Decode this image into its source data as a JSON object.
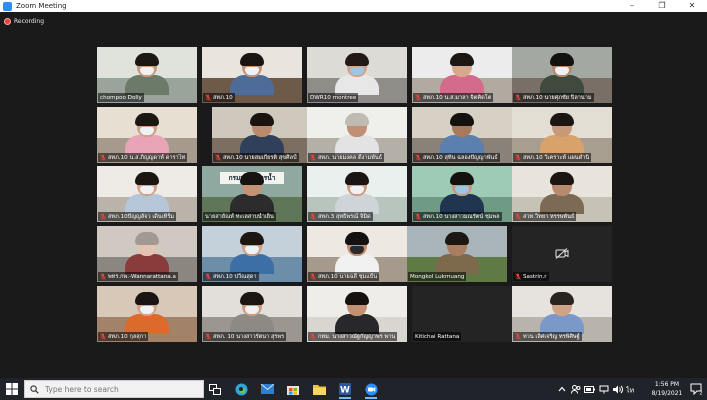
{
  "window": {
    "title": "Zoom Meeting",
    "controls": [
      "–",
      "❐",
      "✕"
    ]
  },
  "recording": {
    "label": "Recording",
    "color": "#e2443a"
  },
  "active_speaker_color": "#a6d64a",
  "participants": [
    {
      "name": "chompoo Dolly",
      "muted": false,
      "active": true
    },
    {
      "name": "สทภ.10",
      "muted": true
    },
    {
      "name": "DWR10 montree",
      "muted": false
    },
    {
      "name": "สทภ.10 น.ส.มาลา จิตคิดโต",
      "muted": true
    },
    {
      "name": "สทภ.10 นายศุภชัย ปิลานาม",
      "muted": true
    },
    {
      "name": "สทภ.10 น.ส.ภิญญดาห์ ดาราไท",
      "muted": true
    },
    {
      "name": "สทภ.10 นายสมเกียรติ สุขศิลป์",
      "muted": true
    },
    {
      "name": "สทภ. นายมงคล ดีงามพันธ์",
      "muted": true
    },
    {
      "name": "สทภ.10 สุทิน ฉลองปัญญาพันธ์",
      "muted": true
    },
    {
      "name": "สทภ.10 วิเคราะห์ แผนดำนิ",
      "muted": true
    },
    {
      "name": "สทภ.10ปัญญลัจว เดินเทิร์ม",
      "muted": true
    },
    {
      "name": "นายสายัณห์ ทะเลสาบน้ำเย็น",
      "muted": false
    },
    {
      "name": "สทภ.3 สุทธิพรณ์ จิมิด",
      "muted": true
    },
    {
      "name": "สทภ.10 นางสาวมณรัตน์ ชุมพล",
      "muted": true
    },
    {
      "name": "สวท.วิทยา หรรษพันธ์",
      "muted": true
    },
    {
      "name": "พทร.กพ.-Wannarattana.a",
      "muted": true
    },
    {
      "name": "สทภ.10 ปวีณสุดา",
      "muted": true
    },
    {
      "name": "สทภ.10 นายฉลี ชุมแป้น",
      "muted": true
    },
    {
      "name": "Mongkol Lukmuang",
      "muted": false
    },
    {
      "name": "Sastrin.r",
      "muted": true,
      "camera_off": true
    },
    {
      "name": "สทภ.10 กุลสุกา",
      "muted": true
    },
    {
      "name": "สทภ. 10 นางสาวรัตนา สุรพร",
      "muted": true
    },
    {
      "name": "กทม. นางสาวณัฐกัญญาพร พาน",
      "muted": true
    },
    {
      "name": "Kitichai Rattana",
      "muted": false
    },
    {
      "name": "ทวน เลิศเจริญ ทรพิศิษฐ์",
      "muted": true
    }
  ],
  "video_sign_text": "กรมทรัพยากรน้ำ",
  "taskbar": {
    "search_placeholder": "Type here to search",
    "clock_time": "1:56 PM",
    "clock_date": "8/19/2021"
  }
}
